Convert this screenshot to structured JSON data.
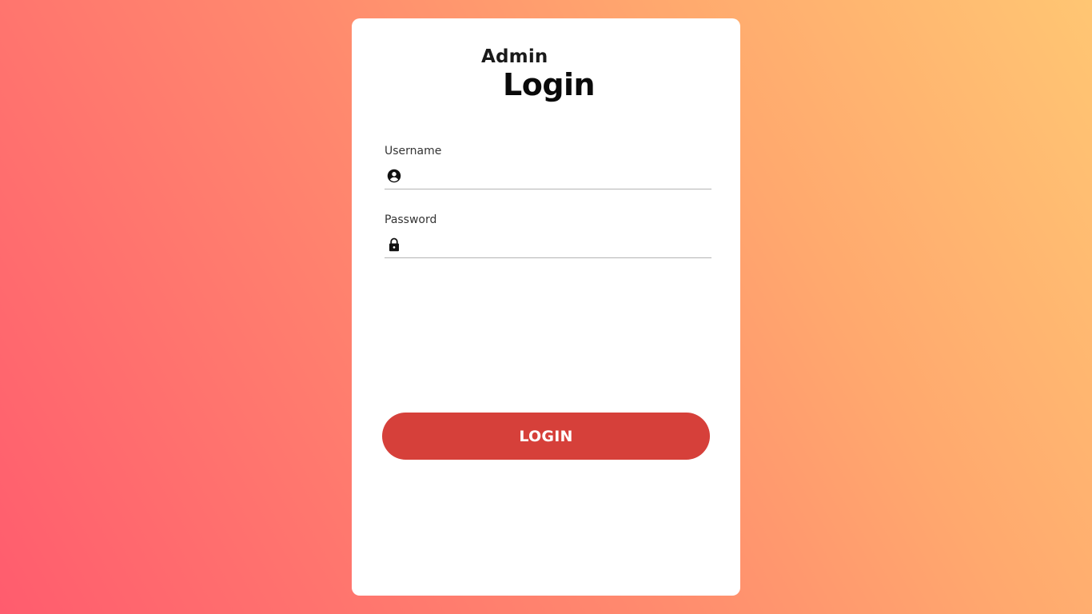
{
  "login": {
    "heading_small": "Admin",
    "heading_large": "Login",
    "username": {
      "label": "Username",
      "value": "",
      "placeholder": "",
      "icon": "user-circle-icon"
    },
    "password": {
      "label": "Password",
      "value": "",
      "placeholder": "",
      "icon": "lock-icon"
    },
    "button_label": "LOGIN"
  },
  "colors": {
    "background_gradient": [
      "#ff5c6e",
      "#ffc673"
    ],
    "card": "#ffffff",
    "button": "#d6403a",
    "button_text": "#ffffff",
    "underline": "#b5b5b5"
  }
}
